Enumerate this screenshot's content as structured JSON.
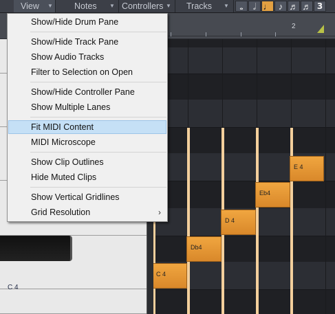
{
  "menubar": {
    "items": [
      {
        "label": "View",
        "arrow": "▼"
      },
      {
        "label": "Notes",
        "arrow": "▼"
      },
      {
        "label": "Controllers",
        "arrow": "▼"
      },
      {
        "label": "Tracks",
        "arrow": "▼"
      }
    ],
    "note_buttons": [
      "𝅝",
      "𝅗𝅥",
      "♩",
      "♪",
      "♬",
      "♬",
      "3"
    ],
    "active_note_index": 2
  },
  "ruler": {
    "measure_label": "2"
  },
  "view_menu": {
    "items": [
      {
        "label": "Show/Hide Drum Pane"
      },
      {
        "label": "Show/Hide Track Pane"
      },
      {
        "label": "Show Audio Tracks"
      },
      {
        "label": "Filter to Selection on Open"
      },
      {
        "label": "Show/Hide Controller Pane"
      },
      {
        "label": "Show Multiple Lanes"
      },
      {
        "label": "Fit MIDI Content",
        "highlighted": true
      },
      {
        "label": "MIDI Microscope"
      },
      {
        "label": "Show Clip Outlines"
      },
      {
        "label": "Hide Muted Clips"
      },
      {
        "label": "Show Vertical Gridlines"
      },
      {
        "label": "Grid Resolution",
        "submenu": "›"
      }
    ]
  },
  "piano": {
    "c4_label": "C 4"
  },
  "notes": [
    {
      "label": "C 4"
    },
    {
      "label": "Db4"
    },
    {
      "label": "D 4"
    },
    {
      "label": "Eb4"
    },
    {
      "label": "E 4"
    }
  ],
  "colors": {
    "note_fill": "#f0a640",
    "menu_highlight": "#c5e0f6",
    "active_tool": "#e2a042"
  }
}
